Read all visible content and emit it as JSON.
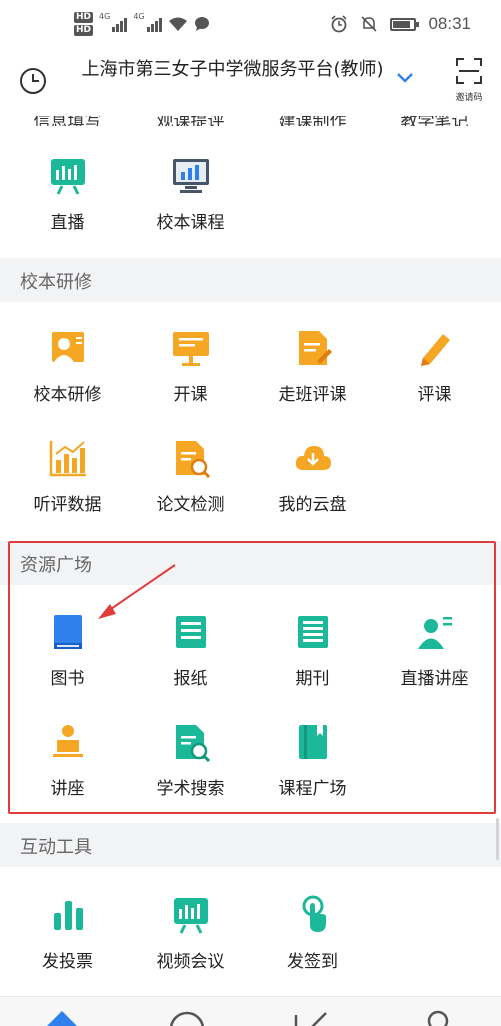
{
  "status_bar": {
    "hd1": "HD",
    "hd2": "HD",
    "net1": "4G",
    "net2": "4G",
    "time": "08:31"
  },
  "header": {
    "title": "上海市第三女子中学微服务平台(教师)",
    "invite_label": "邀请码"
  },
  "top_cutoff": [
    "信息填写",
    "观课提评",
    "建课制作",
    "教学笔记"
  ],
  "sections": [
    {
      "title": "",
      "items": [
        {
          "label": "直播",
          "icon": "live-stream-icon"
        },
        {
          "label": "校本课程",
          "icon": "school-course-icon"
        }
      ]
    },
    {
      "title": "校本研修",
      "items": [
        {
          "label": "校本研修",
          "icon": "teacher-training-icon"
        },
        {
          "label": "开课",
          "icon": "open-class-icon"
        },
        {
          "label": "走班评课",
          "icon": "class-review-icon"
        },
        {
          "label": "评课",
          "icon": "pencil-icon"
        },
        {
          "label": "听评数据",
          "icon": "data-chart-icon"
        },
        {
          "label": "论文检测",
          "icon": "paper-check-icon"
        },
        {
          "label": "我的云盘",
          "icon": "cloud-drive-icon"
        }
      ]
    },
    {
      "title": "资源广场",
      "items": [
        {
          "label": "图书",
          "icon": "book-icon"
        },
        {
          "label": "报纸",
          "icon": "newspaper-icon"
        },
        {
          "label": "期刊",
          "icon": "journal-icon"
        },
        {
          "label": "直播讲座",
          "icon": "live-lecture-icon"
        },
        {
          "label": "讲座",
          "icon": "lecture-icon"
        },
        {
          "label": "学术搜索",
          "icon": "academic-search-icon"
        },
        {
          "label": "课程广场",
          "icon": "course-plaza-icon"
        }
      ]
    },
    {
      "title": "互动工具",
      "items": [
        {
          "label": "发投票",
          "icon": "vote-icon"
        },
        {
          "label": "视频会议",
          "icon": "video-meeting-icon"
        },
        {
          "label": "发签到",
          "icon": "check-in-icon"
        }
      ]
    }
  ],
  "colors": {
    "orange": "#f5a623",
    "green": "#1cb89a",
    "blue": "#2f80ed",
    "highlight": "#e03c3c",
    "section_bg": "#f2f3f5"
  },
  "bottom_nav": [
    {
      "icon": "home-icon"
    },
    {
      "icon": "message-icon"
    },
    {
      "icon": "edit-icon"
    },
    {
      "icon": "profile-icon"
    }
  ]
}
